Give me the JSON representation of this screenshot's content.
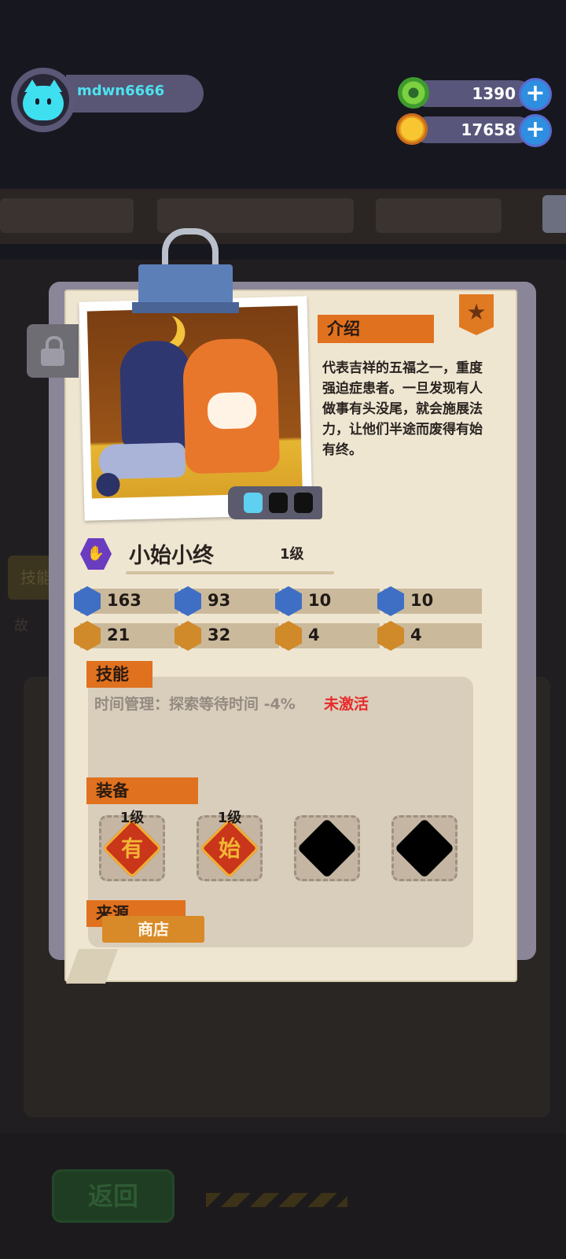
{
  "header": {
    "username": "mdwn6666",
    "currency_green": "1390",
    "currency_gold": "17658",
    "plus_symbol": "+"
  },
  "background": {
    "back_button": "返回",
    "side_tab": "技能",
    "side_tab2": "故"
  },
  "card": {
    "intro_tag": "介绍",
    "intro_text": "代表吉祥的五福之一，重度强迫症患者。一旦发现有人做事有头没尾，就会施展法力，让他们半途而废得有始有终。",
    "name": "小始小终",
    "level": "1级",
    "stats": [
      {
        "icon": "heart-icon",
        "value": "163",
        "color": "#3f6fc4"
      },
      {
        "icon": "bell-icon",
        "value": "93",
        "color": "#3f6fc4"
      },
      {
        "icon": "shield-icon",
        "value": "10",
        "color": "#3f6fc4"
      },
      {
        "icon": "arrow-up-icon",
        "value": "10",
        "color": "#3f6fc4"
      },
      {
        "icon": "dumpling-icon",
        "value": "21",
        "color": "#d08a2a"
      },
      {
        "icon": "smile-icon",
        "value": "32",
        "color": "#d08a2a"
      },
      {
        "icon": "muscle-icon",
        "value": "4",
        "color": "#d08a2a"
      },
      {
        "icon": "brain-icon",
        "value": "4",
        "color": "#d08a2a"
      }
    ],
    "skill_tag": "技能",
    "skill_text": "时间管理：探索等待时间 -4%",
    "skill_status": "未激活",
    "equip_tag": "装备",
    "equipment": [
      {
        "level": "1级",
        "glyph": "有",
        "filled": true
      },
      {
        "level": "1级",
        "glyph": "始",
        "filled": true
      },
      {
        "level": "",
        "glyph": "",
        "filled": false
      },
      {
        "level": "",
        "glyph": "",
        "filled": false
      }
    ],
    "source_tag": "来源",
    "source_button": "商店"
  },
  "colors": {
    "accent_orange": "#e0711f",
    "inactive_red": "#e82a2a",
    "avatar_cyan": "#3ee0f0"
  }
}
